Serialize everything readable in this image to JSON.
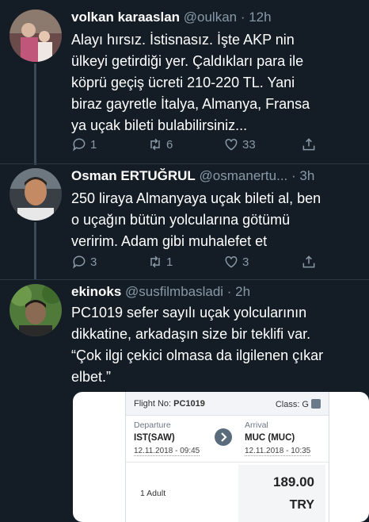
{
  "tweets": [
    {
      "name": "volkan karaaslan",
      "handle": "@oulkan · 12h",
      "lines": [
        "Alayı hırsız. İstisnasız. İşte AKP nin",
        "ülkeyi getirdiği yer. Çaldıkları para ile",
        "köprü geçiş ücreti 210-220 TL. Yani",
        "biraz gayretle  İtalya, Almanya, Fransa",
        "ya uçak bileti bulabilirsiniz..."
      ],
      "replies": "1",
      "retweets": "6",
      "likes": "33"
    },
    {
      "name": "Osman ERTUĞRUL",
      "handle": "@osmanertu... · 3h",
      "lines": [
        "250 liraya Almanyaya uçak bileti al, ben",
        "o uçağın bütün yolcularına götümü",
        "veririm. Adam gibi muhalefet et"
      ],
      "replies": "3",
      "retweets": "1",
      "likes": "3"
    },
    {
      "name": "ekinoks",
      "handle": "@susfilmbasladi · 2h",
      "lines": [
        "PC1019 sefer sayılı uçak yolcularının",
        "dikkatine, arkadaşın size bir teklifi var.",
        "“Çok ilgi çekici olmasa da ilgilenen çıkar",
        "elbet.”"
      ]
    }
  ],
  "ticket": {
    "flight_label": "Flight No:",
    "flight_no": "PC1019",
    "class_label": "Class: G",
    "departure_label": "Departure",
    "departure_code": "IST(SAW)",
    "departure_date": "12.11.2018 - 09:45",
    "arrival_label": "Arrival",
    "arrival_code": "MUC (MUC)",
    "arrival_date": "12.11.2018 - 10:35",
    "passenger": "1 Adult",
    "price": "189.00",
    "currency": "TRY"
  },
  "icons": [
    "reply-icon",
    "retweet-icon",
    "like-icon",
    "share-icon",
    "arrow-right-icon"
  ],
  "colors": {
    "background": "#141d26",
    "muted": "#8899a6",
    "divider": "#2a3642"
  }
}
